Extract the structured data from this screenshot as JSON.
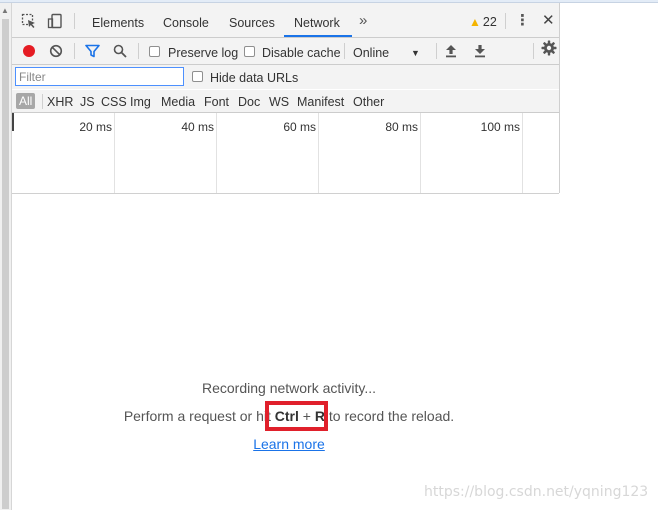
{
  "tabs": {
    "items": [
      "Elements",
      "Console",
      "Sources",
      "Network"
    ],
    "more": "»",
    "warnings": "22",
    "kebab": "⋮",
    "close": "✕"
  },
  "toolbar": {
    "preserve_log": "Preserve log",
    "disable_cache": "Disable cache",
    "throttling": "Online",
    "throttling_caret": "▼"
  },
  "filter": {
    "placeholder": "Filter",
    "hide_data_urls": "Hide data URLs"
  },
  "types": [
    "All",
    "XHR",
    "JS",
    "CSS",
    "Img",
    "Media",
    "Font",
    "Doc",
    "WS",
    "Manifest",
    "Other"
  ],
  "overview": {
    "ticks": [
      "20 ms",
      "40 ms",
      "60 ms",
      "80 ms",
      "100 ms"
    ]
  },
  "empty": {
    "line1": "Recording network activity...",
    "line2_prefix": "Perform a request or hit ",
    "shortcut_key": "Ctrl",
    "shortcut_plus": " + ",
    "shortcut_key2": "R",
    "line2_suffix": " to record the reload.",
    "learn_more": "Learn more"
  },
  "watermark": "https://blog.csdn.net/yqning123",
  "colors": {
    "record": "#e51c23",
    "accent": "#1a73e8",
    "warning": "#f4b400",
    "highlight": "#e0202b"
  }
}
